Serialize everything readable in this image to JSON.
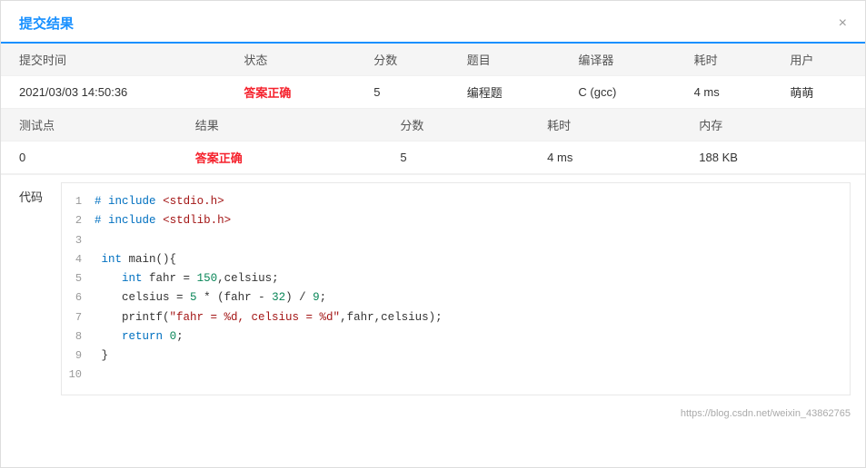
{
  "dialog": {
    "title": "提交结果",
    "close_label": "×"
  },
  "table1": {
    "headers": [
      "提交时间",
      "状态",
      "分数",
      "题目",
      "编译器",
      "耗时",
      "用户"
    ],
    "rows": [
      {
        "submit_time": "2021/03/03 14:50:36",
        "status": "答案正确",
        "score": "5",
        "problem": "编程题",
        "compiler": "C (gcc)",
        "time": "4 ms",
        "user": "萌萌"
      }
    ]
  },
  "table2": {
    "headers": [
      "测试点",
      "结果",
      "分数",
      "耗时",
      "内存"
    ],
    "rows": [
      {
        "test_point": "0",
        "result": "答案正确",
        "score": "5",
        "time": "4 ms",
        "memory": "188 KB"
      }
    ]
  },
  "code": {
    "label": "代码",
    "lines": [
      {
        "num": "1",
        "content": "# include <stdio.h>"
      },
      {
        "num": "2",
        "content": "# include <stdlib.h>"
      },
      {
        "num": "3",
        "content": ""
      },
      {
        "num": "4",
        "content": " int main(){"
      },
      {
        "num": "5",
        "content": "    int fahr = 150,celsius;"
      },
      {
        "num": "6",
        "content": "    celsius = 5 * (fahr - 32) / 9;"
      },
      {
        "num": "7",
        "content": "    printf(\"fahr = %d, celsius = %d\",fahr,celsius);"
      },
      {
        "num": "8",
        "content": "    return 0;"
      },
      {
        "num": "9",
        "content": " }"
      },
      {
        "num": "10",
        "content": ""
      }
    ]
  },
  "watermark": "https://blog.csdn.net/weixin_43862765"
}
